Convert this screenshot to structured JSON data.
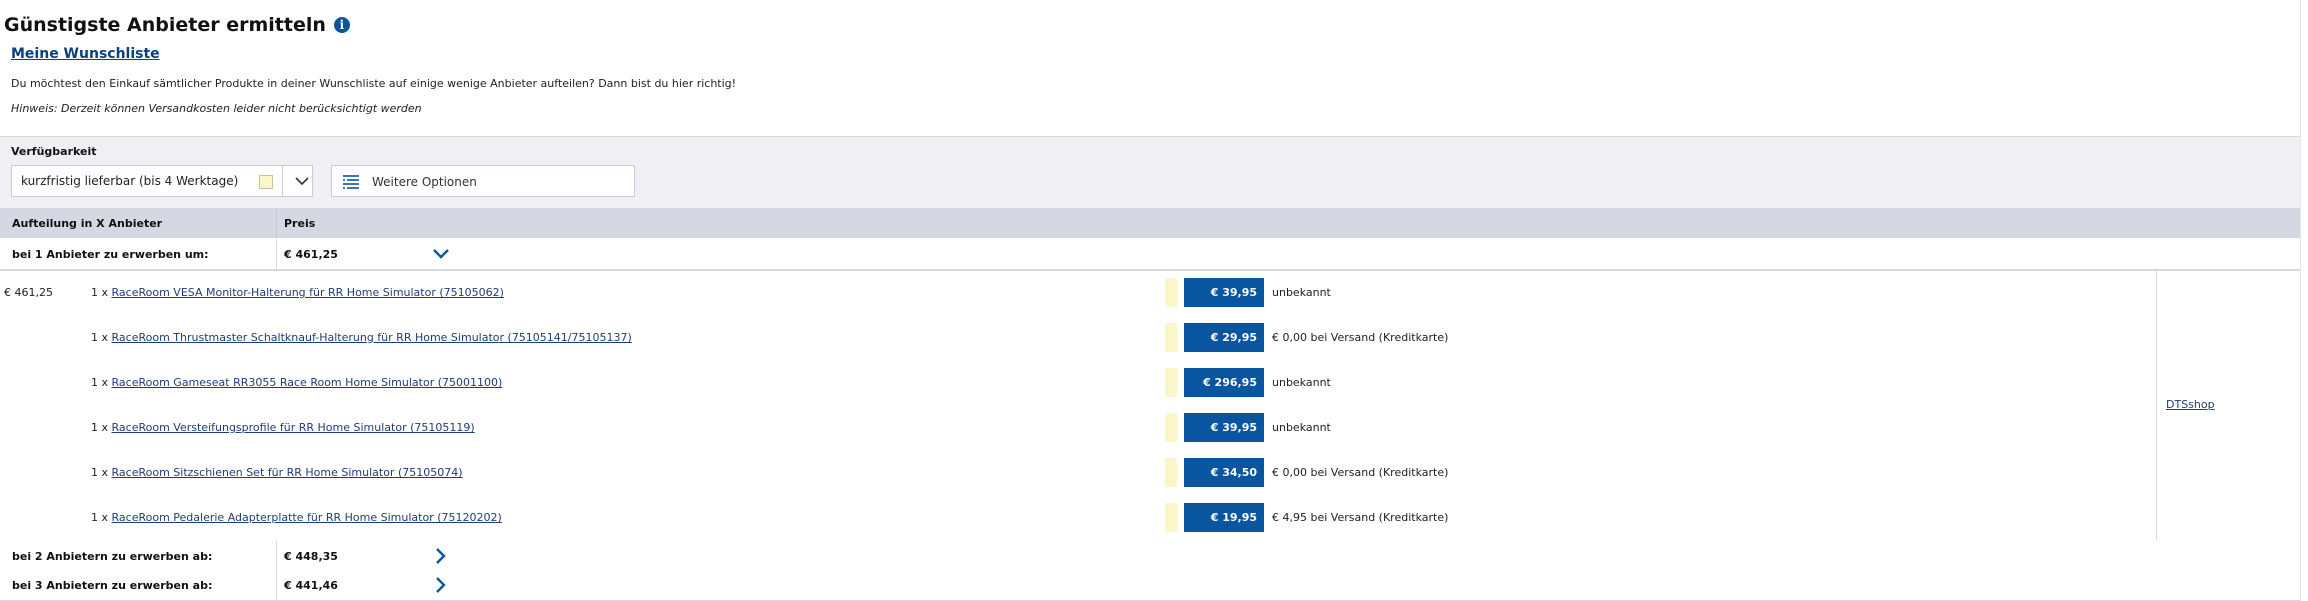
{
  "header": {
    "title": "Günstigste Anbieter ermitteln",
    "info_icon": "info-icon",
    "wishlist_link": "Meine Wunschliste",
    "intro": "Du möchtest den Einkauf sämtlicher Produkte in deiner Wunschliste auf einige wenige Anbieter aufteilen? Dann bist du hier richtig!",
    "hint": "Hinweis: Derzeit können Versandkosten leider nicht berücksichtigt werden"
  },
  "filter": {
    "label": "Verfügbarkeit",
    "availability_value": "kurzfristig lieferbar (bis 4 Werktage)",
    "availability_color": "#fbf6c9",
    "more_options_label": "Weitere Optionen"
  },
  "table": {
    "col_split": "Aufteilung in X Anbieter",
    "col_price": "Preis",
    "rows": [
      {
        "label": "bei 1 Anbieter zu erwerben um:",
        "price": "€ 461,25",
        "expanded": true
      },
      {
        "label": "bei 2 Anbietern zu erwerben ab:",
        "price": "€ 448,35",
        "expanded": false
      },
      {
        "label": "bei 3 Anbietern zu erwerben ab:",
        "price": "€ 441,46",
        "expanded": false
      }
    ]
  },
  "detail": {
    "total": "€ 461,25",
    "shop": "DTSshop",
    "items": [
      {
        "qty": "1 x",
        "name": "RaceRoom VESA Monitor-Halterung für RR Home Simulator (75105062)",
        "price": "€ 39,95",
        "shipping": "unbekannt"
      },
      {
        "qty": "1 x",
        "name": "RaceRoom Thrustmaster Schaltknauf-Halterung für RR Home Simulator (75105141/75105137)",
        "price": "€ 29,95",
        "shipping": "€ 0,00 bei Versand (Kreditkarte)"
      },
      {
        "qty": "1 x",
        "name": "RaceRoom Gameseat RR3055 Race Room Home Simulator (75001100)",
        "price": "€ 296,95",
        "shipping": "unbekannt"
      },
      {
        "qty": "1 x",
        "name": "RaceRoom Versteifungsprofile für RR Home Simulator (75105119)",
        "price": "€ 39,95",
        "shipping": "unbekannt"
      },
      {
        "qty": "1 x",
        "name": "RaceRoom Sitzschienen Set für RR Home Simulator (75105074)",
        "price": "€ 34,50",
        "shipping": "€ 0,00 bei Versand (Kreditkarte)"
      },
      {
        "qty": "1 x",
        "name": "RaceRoom Pedalerie Adapterplatte für RR Home Simulator (75120202)",
        "price": "€ 19,95",
        "shipping": "€ 4,95 bei Versand (Kreditkarte)"
      }
    ]
  },
  "colors": {
    "accent": "#0a55a0",
    "link": "#1e3d78",
    "header_band": "#d3d8e2",
    "filter_band": "#eef0f4"
  }
}
